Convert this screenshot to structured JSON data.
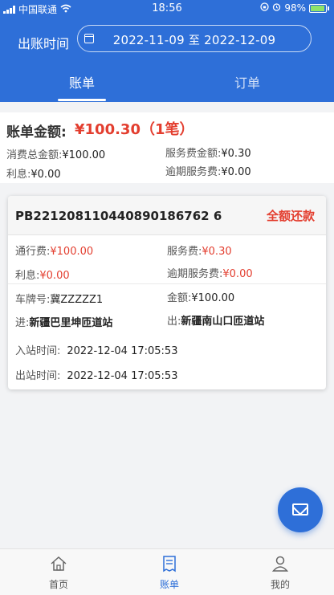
{
  "status_bar": {
    "carrier": "中国联通",
    "time": "18:56",
    "battery": "98%"
  },
  "date_filter": {
    "label": "出账时间",
    "start": "2022-11-09",
    "separator": "至",
    "end": "2022-12-09"
  },
  "tabs": [
    {
      "label": "账单",
      "active": true
    },
    {
      "label": "订单",
      "active": false
    }
  ],
  "summary": {
    "total_label": "账单金额:",
    "total_value": "¥100.30（1笔）",
    "consume_total_label": "消费总金额:",
    "consume_total_value": "¥100.00",
    "service_fee_label": "服务费金额:",
    "service_fee_value": "¥0.30",
    "interest_label": "利息:",
    "interest_value": "¥0.00",
    "overdue_fee_label": "逾期服务费:",
    "overdue_fee_value": "¥0.00"
  },
  "bill": {
    "order_no": "PB221208110440890186762 6",
    "status": "全额还款",
    "toll_label": "通行费:",
    "toll_value": "¥100.00",
    "service_label": "服务费:",
    "service_value": "¥0.30",
    "interest_label": "利息:",
    "interest_value": "¥0.00",
    "overdue_label": "逾期服务费:",
    "overdue_value": "¥0.00",
    "plate_label": "车牌号:",
    "plate_value": "冀ZZZZZ1",
    "amount_label": "金额:",
    "amount_value": "¥100.00",
    "entry_label": "进:",
    "entry_value": "新疆巴里坤匝道站",
    "exit_label": "出:",
    "exit_value": "新疆南山口匝道站",
    "entry_time_label": "入站时间:",
    "entry_time_value": "2022-12-04 17:05:53",
    "exit_time_label": "出站时间:",
    "exit_time_value": "2022-12-04 17:05:53"
  },
  "fab": {
    "icon": "mail-icon"
  },
  "bottom_nav": [
    {
      "label": "首页",
      "icon": "home-icon",
      "active": false
    },
    {
      "label": "账单",
      "icon": "bill-icon",
      "active": true
    },
    {
      "label": "我的",
      "icon": "user-icon",
      "active": false
    }
  ],
  "colors": {
    "primary": "#2e6fd8",
    "accent_red": "#e33e2f",
    "background": "#f2f3f5"
  }
}
